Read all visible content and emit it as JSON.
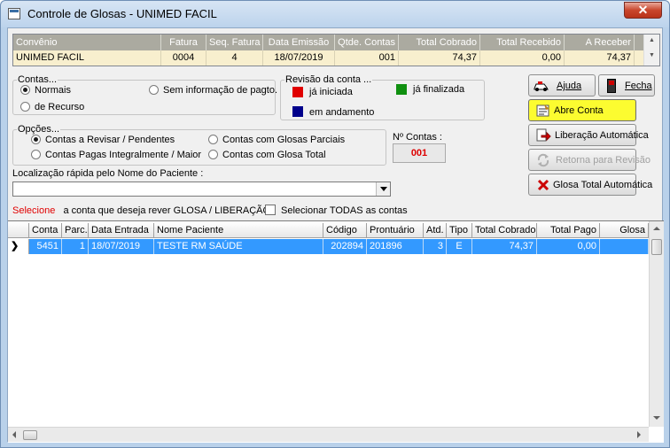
{
  "window": {
    "title": "Controle de Glosas - UNIMED FACIL",
    "close_label": "✕"
  },
  "summary": {
    "columns": [
      "Convênio",
      "Fatura",
      "Seq. Fatura",
      "Data Emissão",
      "Qtde. Contas",
      "Total Cobrado",
      "Total Recebido",
      "A Receber"
    ],
    "row": [
      "UNIMED FACIL",
      "0004",
      "4",
      "18/07/2019",
      "001",
      "74,37",
      "0,00",
      "74,37"
    ]
  },
  "contas_group": {
    "legend": "Contas...",
    "options": [
      "Normais",
      "Sem informação de pagto.",
      "de Recurso"
    ],
    "selected": "Normais"
  },
  "revisao_group": {
    "legend": "Revisão da conta ...",
    "items": [
      {
        "label": "já iniciada",
        "color": "#e00000"
      },
      {
        "label": "já finalizada",
        "color": "#109010"
      },
      {
        "label": "em andamento",
        "color": "#00008b"
      }
    ]
  },
  "opcoes_group": {
    "legend": "Opções...",
    "options": [
      "Contas a Revisar / Pendentes",
      "Contas com Glosas Parciais",
      "Contas Pagas Integralmente / Maior",
      "Contas com Glosa Total"
    ],
    "selected": "Contas a Revisar / Pendentes"
  },
  "num_contas": {
    "label": "Nº Contas :",
    "value": "001"
  },
  "search": {
    "label": "Localização rápida pelo Nome do Paciente :",
    "value": ""
  },
  "instruction": {
    "highlight": "Selecione",
    "text": "a conta que deseja rever GLOSA / LIBERAÇÃO:",
    "checkbox_label": "Selecionar TODAS as contas"
  },
  "buttons": {
    "ajuda": "Ajuda",
    "fecha": "Fecha",
    "abre_conta": "Abre Conta",
    "liberacao": "Liberação Automática",
    "retorna": "Retorna para Revisão",
    "glosa_total": "Glosa Total Automática"
  },
  "accounts": {
    "columns": [
      "Conta",
      "Parc.",
      "Data Entrada",
      "Nome Paciente",
      "Código",
      "Prontuário",
      "Atd.",
      "Tipo",
      "Total Cobrado",
      "Total Pago",
      "Glosa"
    ],
    "rows": [
      [
        "5451",
        "1",
        "18/07/2019",
        "TESTE RM SAÚDE",
        "202894",
        "201896",
        "3",
        "E",
        "74,37",
        "0,00",
        ""
      ]
    ],
    "selection_color": "#3399ff"
  }
}
